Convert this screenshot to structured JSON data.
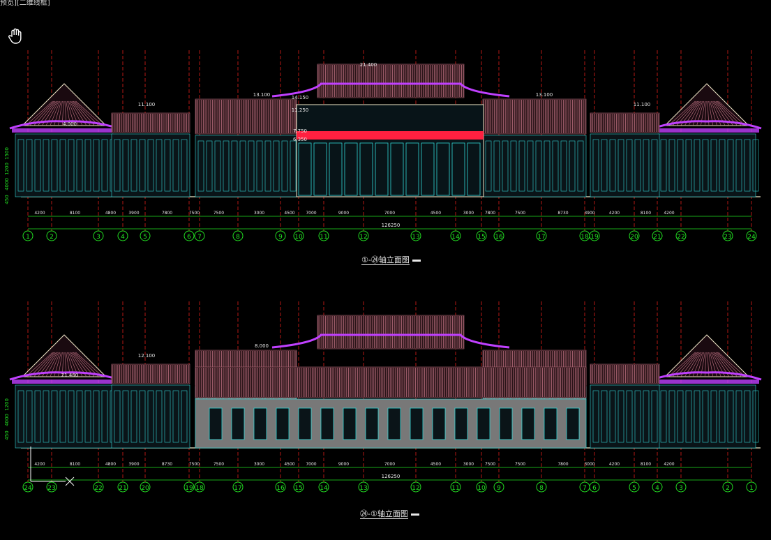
{
  "window": {
    "status_text": "预览][二维线框]"
  },
  "colors": {
    "background": "#000000",
    "grid_line": "#e0201a",
    "dimension": "#22e022",
    "roof_tile": "#b06878",
    "eave": "#c040ff",
    "facade": "#32d8d8",
    "cream": "#f0e8c8",
    "red_band": "#ff2040",
    "wall_gray": "#787878",
    "label": "#e8e8e8"
  },
  "elevations": [
    {
      "caption": "①-㉔轴立面图",
      "total_width": "126250",
      "heights": [
        "4.000",
        "11.100",
        "13.100",
        "21.400",
        "14.150",
        "11.250",
        "7.750",
        "6.350",
        "13.100",
        "11.100"
      ],
      "left_dims": [
        "1500",
        "1200",
        "4000",
        "450"
      ],
      "axis_labels": [
        "1",
        "2",
        "3",
        "4",
        "5",
        "6",
        "7",
        "8",
        "9",
        "10",
        "11",
        "12",
        "13",
        "14",
        "15",
        "16",
        "17",
        "18",
        "19",
        "20",
        "21",
        "22",
        "23",
        "24"
      ],
      "bay_dims": [
        "4200",
        "8100",
        "4800",
        "3900",
        "7800",
        "7500",
        "7500",
        "3000",
        "4500",
        "7000",
        "9000",
        "7000",
        "4500",
        "3000",
        "7800",
        "7500",
        "8730",
        "3900",
        "4200",
        "8100",
        "4200"
      ]
    },
    {
      "caption": "㉔-①轴立面图",
      "total_width": "126250",
      "heights": [
        "21.400",
        "12.100",
        "8.000"
      ],
      "left_dims": [
        "1200",
        "4000",
        "450"
      ],
      "axis_labels": [
        "24",
        "23",
        "22",
        "21",
        "20",
        "19",
        "18",
        "17",
        "16",
        "15",
        "14",
        "13",
        "12",
        "11",
        "10",
        "9",
        "8",
        "7",
        "6",
        "5",
        "4",
        "3",
        "2",
        "1"
      ],
      "bay_dims": [
        "4200",
        "8100",
        "4800",
        "3900",
        "8730",
        "7500",
        "7500",
        "3000",
        "4500",
        "7000",
        "9000",
        "7000",
        "4500",
        "3000",
        "7500",
        "7500",
        "7800",
        "3000",
        "4200",
        "8100",
        "4200"
      ]
    }
  ],
  "icons": {
    "pan": "hand-pan-icon",
    "ucs": "ucs-axis-icon"
  }
}
